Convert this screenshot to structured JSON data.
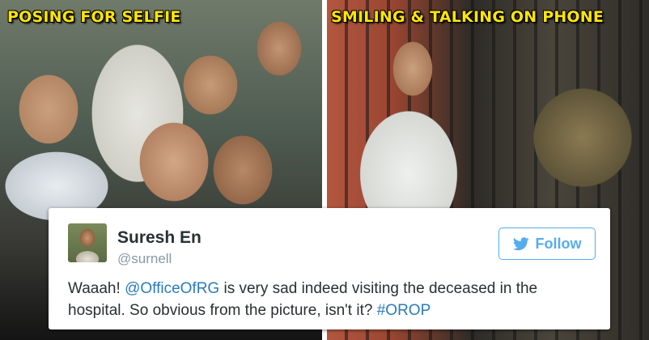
{
  "captions": {
    "left": "POSING FOR SELFIE",
    "right": "SMILING & TALKING ON PHONE"
  },
  "caption_color": "#ffe600",
  "tweet": {
    "name": "Suresh En",
    "handle": "@surnell",
    "follow_label": "Follow",
    "follow_icon": "twitter-bird-icon",
    "accent_color": "#55acee",
    "text_before": "Waaah! ",
    "mention": "@OfficeOfRG",
    "text_middle": " is very sad indeed visiting the deceased in the hospital. So obvious from the picture, isn't it? ",
    "hashtag": "#OROP"
  }
}
